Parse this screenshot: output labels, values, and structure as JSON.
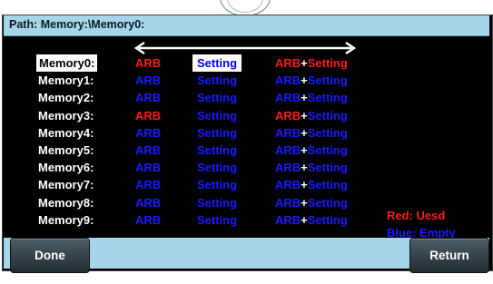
{
  "path_label": "Path: Memory:\\Memory0:",
  "memory_rows": [
    {
      "name": "Memory0:",
      "arb": "ARB",
      "arb_color": "red",
      "setting": "Setting",
      "combo_arb": "ARB",
      "combo_arb_color": "red",
      "combo_plus": "+",
      "combo_setting": "Setting",
      "combo_setting_color": "red"
    },
    {
      "name": "Memory1:",
      "arb": "ARB",
      "arb_color": "blue",
      "setting": "Setting",
      "combo_arb": "ARB",
      "combo_arb_color": "blue",
      "combo_plus": "+",
      "combo_setting": "Setting",
      "combo_setting_color": "blue"
    },
    {
      "name": "Memory2:",
      "arb": "ARB",
      "arb_color": "blue",
      "setting": "Setting",
      "combo_arb": "ARB",
      "combo_arb_color": "blue",
      "combo_plus": "+",
      "combo_setting": "Setting",
      "combo_setting_color": "blue"
    },
    {
      "name": "Memory3:",
      "arb": "ARB",
      "arb_color": "red",
      "setting": "Setting",
      "combo_arb": "ARB",
      "combo_arb_color": "red",
      "combo_plus": "+",
      "combo_setting": "Setting",
      "combo_setting_color": "blue"
    },
    {
      "name": "Memory4:",
      "arb": "ARB",
      "arb_color": "blue",
      "setting": "Setting",
      "combo_arb": "ARB",
      "combo_arb_color": "blue",
      "combo_plus": "+",
      "combo_setting": "Setting",
      "combo_setting_color": "blue"
    },
    {
      "name": "Memory5:",
      "arb": "ARB",
      "arb_color": "blue",
      "setting": "Setting",
      "combo_arb": "ARB",
      "combo_arb_color": "blue",
      "combo_plus": "+",
      "combo_setting": "Setting",
      "combo_setting_color": "blue"
    },
    {
      "name": "Memory6:",
      "arb": "ARB",
      "arb_color": "blue",
      "setting": "Setting",
      "combo_arb": "ARB",
      "combo_arb_color": "blue",
      "combo_plus": "+",
      "combo_setting": "Setting",
      "combo_setting_color": "blue"
    },
    {
      "name": "Memory7:",
      "arb": "ARB",
      "arb_color": "blue",
      "setting": "Setting",
      "combo_arb": "ARB",
      "combo_arb_color": "blue",
      "combo_plus": "+",
      "combo_setting": "Setting",
      "combo_setting_color": "blue"
    },
    {
      "name": "Memory8:",
      "arb": "ARB",
      "arb_color": "blue",
      "setting": "Setting",
      "combo_arb": "ARB",
      "combo_arb_color": "blue",
      "combo_plus": "+",
      "combo_setting": "Setting",
      "combo_setting_color": "blue"
    },
    {
      "name": "Memory9:",
      "arb": "ARB",
      "arb_color": "blue",
      "setting": "Setting",
      "combo_arb": "ARB",
      "combo_arb_color": "blue",
      "combo_plus": "+",
      "combo_setting": "Setting",
      "combo_setting_color": "blue"
    }
  ],
  "selected_row": 0,
  "selected_column": "setting",
  "legend": {
    "used": "Red: Uesd",
    "empty": "Blue: Empty"
  },
  "buttons": {
    "done": "Done",
    "return": "Return"
  },
  "colors": {
    "red": "#ff1a1a",
    "blue": "#1a1aff",
    "path_bar": "#a6d5ea",
    "screen": "#000000"
  }
}
